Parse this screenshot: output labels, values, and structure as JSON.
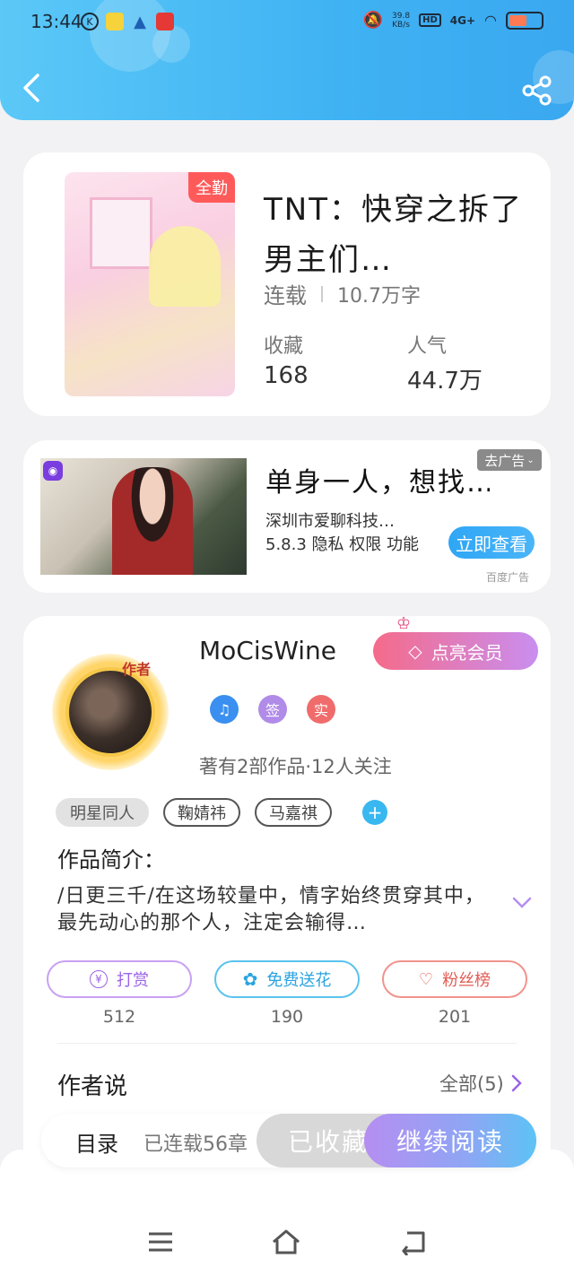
{
  "status_bar": {
    "time": "13:44",
    "net_speed_value": "39.8",
    "net_speed_unit": "KB/s",
    "hd": "HD",
    "signal": "4G+",
    "battery_level": 0.55
  },
  "header": {
    "back_icon": "chevron-left-icon",
    "share_icon": "share-icon"
  },
  "book": {
    "cover_badge": "全勤",
    "title": "TNT：快穿之拆了男主们…",
    "status": "连载",
    "word_count": "10.7万字",
    "stats": [
      {
        "label": "收藏",
        "value": "168"
      },
      {
        "label": "人气",
        "value": "44.7万"
      }
    ]
  },
  "ad": {
    "title": "单身一人，想找…",
    "dismiss": "去广告",
    "company": "深圳市爱聊科技…",
    "meta": "5.8.3 隐私 权限 功能",
    "cta": "立即查看",
    "source": "百度广告"
  },
  "author": {
    "avatar_tag": "作者",
    "name": "MoCisWine",
    "vip_button": "点亮会员",
    "badges": [
      "签",
      "实"
    ],
    "works_summary": "著有2部作品·12人关注",
    "tags": [
      "明星同人",
      "鞠婧祎",
      "马嘉祺"
    ],
    "intro_label": "作品简介：",
    "intro_text": "/日更三千/在这场较量中，情字始终贯穿其中，最先动心的那个人，注定会输得…",
    "actions": [
      {
        "label": "打赏",
        "count": "512"
      },
      {
        "label": "免费送花",
        "count": "190"
      },
      {
        "label": "粉丝榜",
        "count": "201"
      }
    ],
    "says_label": "作者说",
    "says_all": "全部(5)"
  },
  "bottom_bar": {
    "toc_label": "目录",
    "toc_count": "已连载56章",
    "collected_button": "已收藏",
    "read_button": "继续阅读"
  },
  "colors": {
    "header": "#3fb2f3",
    "accent_blue": "#39b7f0",
    "vip_pink": "#f56b8a",
    "read_purple": "#b58ef2"
  }
}
